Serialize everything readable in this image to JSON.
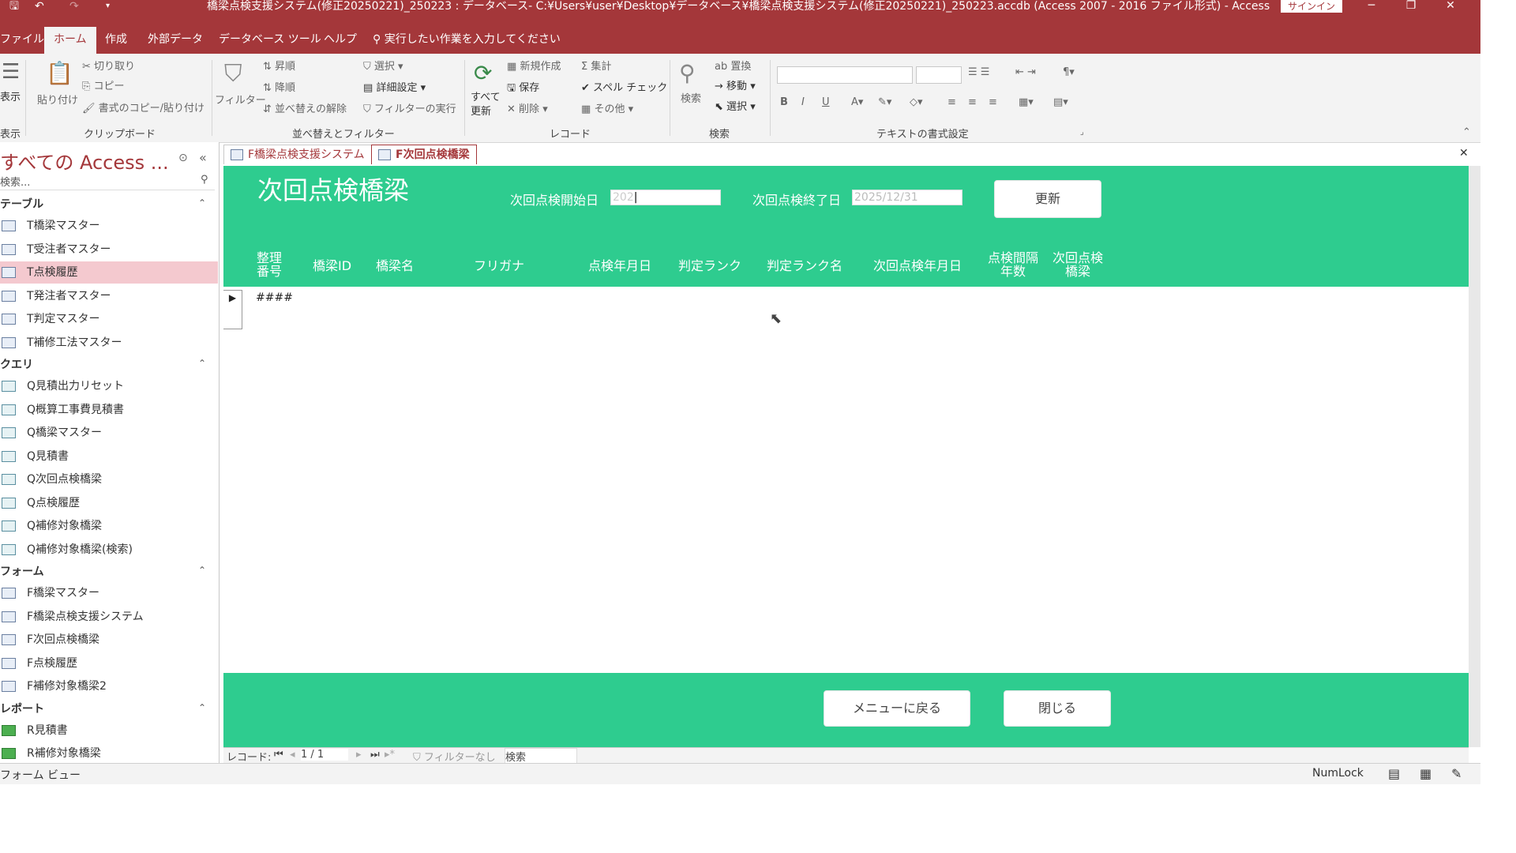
{
  "titlebar": {
    "title": "橋梁点検支援システム(修正20250221)_250223 : データベース- C:¥Users¥user¥Desktop¥データベース¥橋梁点検支援システム(修正20250221)_250223.accdb (Access 2007 - 2016 ファイル形式) - Access",
    "signin": "サインイン",
    "minimize": "─",
    "restore": "❐",
    "close": "✕"
  },
  "menu": {
    "file": "ファイル",
    "home": "ホーム",
    "create": "作成",
    "external": "外部データ",
    "dbtools": "データベース ツール",
    "help": "ヘルプ",
    "tellme": "実行したい作業を入力してください"
  },
  "ribbon": {
    "view": "表示",
    "view_group": "表示",
    "paste": "貼り付け",
    "cut": "切り取り",
    "copy": "コピー",
    "format_painter": "書式のコピー/貼り付け",
    "clipboard_group": "クリップボード",
    "filter": "フィルター",
    "ascending": "昇順",
    "descending": "降順",
    "remove_sort": "並べ替えの解除",
    "selection": "選択",
    "advanced": "詳細設定",
    "toggle_filter": "フィルターの実行",
    "sort_group": "並べ替えとフィルター",
    "refresh_all_1": "すべて",
    "refresh_all_2": "更新",
    "new": "新規作成",
    "save": "保存",
    "delete": "削除",
    "totals": "集計",
    "spelling": "スペル チェック",
    "more": "その他",
    "records_group": "レコード",
    "find": "検索",
    "replace": "置換",
    "goto": "移動",
    "select": "選択",
    "find_group": "検索",
    "bold": "B",
    "italic": "I",
    "underline": "U",
    "text_format_group": "テキストの書式設定"
  },
  "nav": {
    "title": "すべての Access ...",
    "search_placeholder": "検索...",
    "sections": [
      {
        "header": "テーブル",
        "items": [
          "T橋梁マスター",
          "T受注者マスター",
          "T点検履歴",
          "T発注者マスター",
          "T判定マスター",
          "T補修工法マスター"
        ]
      },
      {
        "header": "クエリ",
        "items": [
          "Q見積出力リセット",
          "Q概算工事費見積書",
          "Q橋梁マスター",
          "Q見積書",
          "Q次回点検橋梁",
          "Q点検履歴",
          "Q補修対象橋梁",
          "Q補修対象橋梁(検索)"
        ]
      },
      {
        "header": "フォーム",
        "items": [
          "F橋梁マスター",
          "F橋梁点検支援システム",
          "F次回点検橋梁",
          "F点検履歴",
          "F補修対象橋梁2"
        ]
      },
      {
        "header": "レポート",
        "items": [
          "R見積書",
          "R補修対象橋梁"
        ]
      }
    ]
  },
  "doctabs": [
    "F橋梁点検支援システム",
    "F次回点検橋梁"
  ],
  "form": {
    "title": "次回点検橋梁",
    "start_label": "次回点検開始日",
    "start_value": "202",
    "end_label": "次回点検終了日",
    "end_value": "2025/12/31",
    "update_button": "更新",
    "columns": {
      "seq_1": "整理",
      "seq_2": "番号",
      "bridge_id": "橋梁ID",
      "bridge_name": "橋梁名",
      "furigana": "フリガナ",
      "inspect_date": "点検年月日",
      "rank": "判定ランク",
      "rank_name": "判定ランク名",
      "next_date": "次回点検年月日",
      "interval_1": "点検間隔",
      "interval_2": "年数",
      "next_bridge_1": "次回点検",
      "next_bridge_2": "橋梁"
    },
    "row_value": "####",
    "back_button": "メニューに戻る",
    "close_button": "閉じる"
  },
  "recnav": {
    "label": "レコード:",
    "position": "1 / 1",
    "no_filter": "フィルターなし",
    "search": "検索"
  },
  "status": {
    "mode": "フォーム ビュー",
    "numlock": "NumLock"
  }
}
